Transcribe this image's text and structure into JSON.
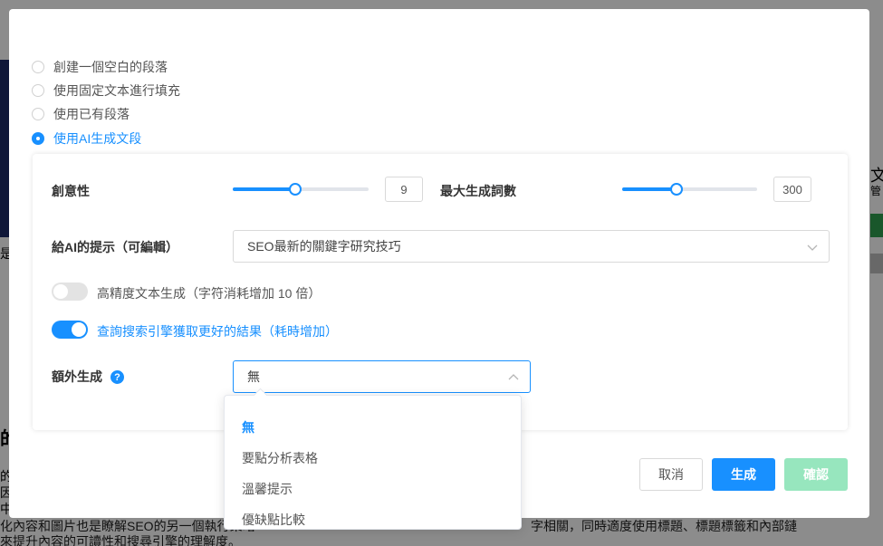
{
  "background": {
    "left_fragment_1": "是",
    "bottom_lines": [
      "化內容和圖片也是瞭解SEO的另一個執行策略",
      "來提升內容的可讀性和搜尋引擎的理解度。"
    ],
    "bottom_right_fragment": "字相關，同時適度使用標題、標題標籤和內部鏈",
    "left_partial_lines": [
      "的",
      "因",
      "中"
    ],
    "right_fragment": "文",
    "right_fragment_2": "管",
    "left_title_fragment": "的"
  },
  "radio_options": [
    {
      "label": "創建一個空白的段落",
      "checked": false
    },
    {
      "label": "使用固定文本進行填充",
      "checked": false
    },
    {
      "label": "使用已有段落",
      "checked": false
    },
    {
      "label": "使用AI生成文段",
      "checked": true
    }
  ],
  "creativity": {
    "label": "創意性",
    "value": "9",
    "level": 0.46
  },
  "max_words": {
    "label": "最大生成詞數",
    "value": "300",
    "level": 0.4
  },
  "prompt": {
    "label": "給AI的提示（可編輯）",
    "value": "SEO最新的關鍵字研究技巧"
  },
  "high_precision": {
    "label": "高精度文本生成（字符消耗增加 10 倍）",
    "enabled": false
  },
  "search_engine": {
    "label": "查詢搜索引擎獲取更好的結果（耗時增加）",
    "enabled": true
  },
  "extra": {
    "label": "額外生成",
    "help_icon": "?",
    "value": "無",
    "options": [
      "無",
      "要點分析表格",
      "溫馨提示",
      "優缺點比較"
    ],
    "selected_index": 0
  },
  "buttons": {
    "cancel": "取消",
    "generate": "生成",
    "confirm": "確認"
  },
  "colors": {
    "accent": "#1890ff",
    "confirm_disabled": "#97e6be"
  }
}
